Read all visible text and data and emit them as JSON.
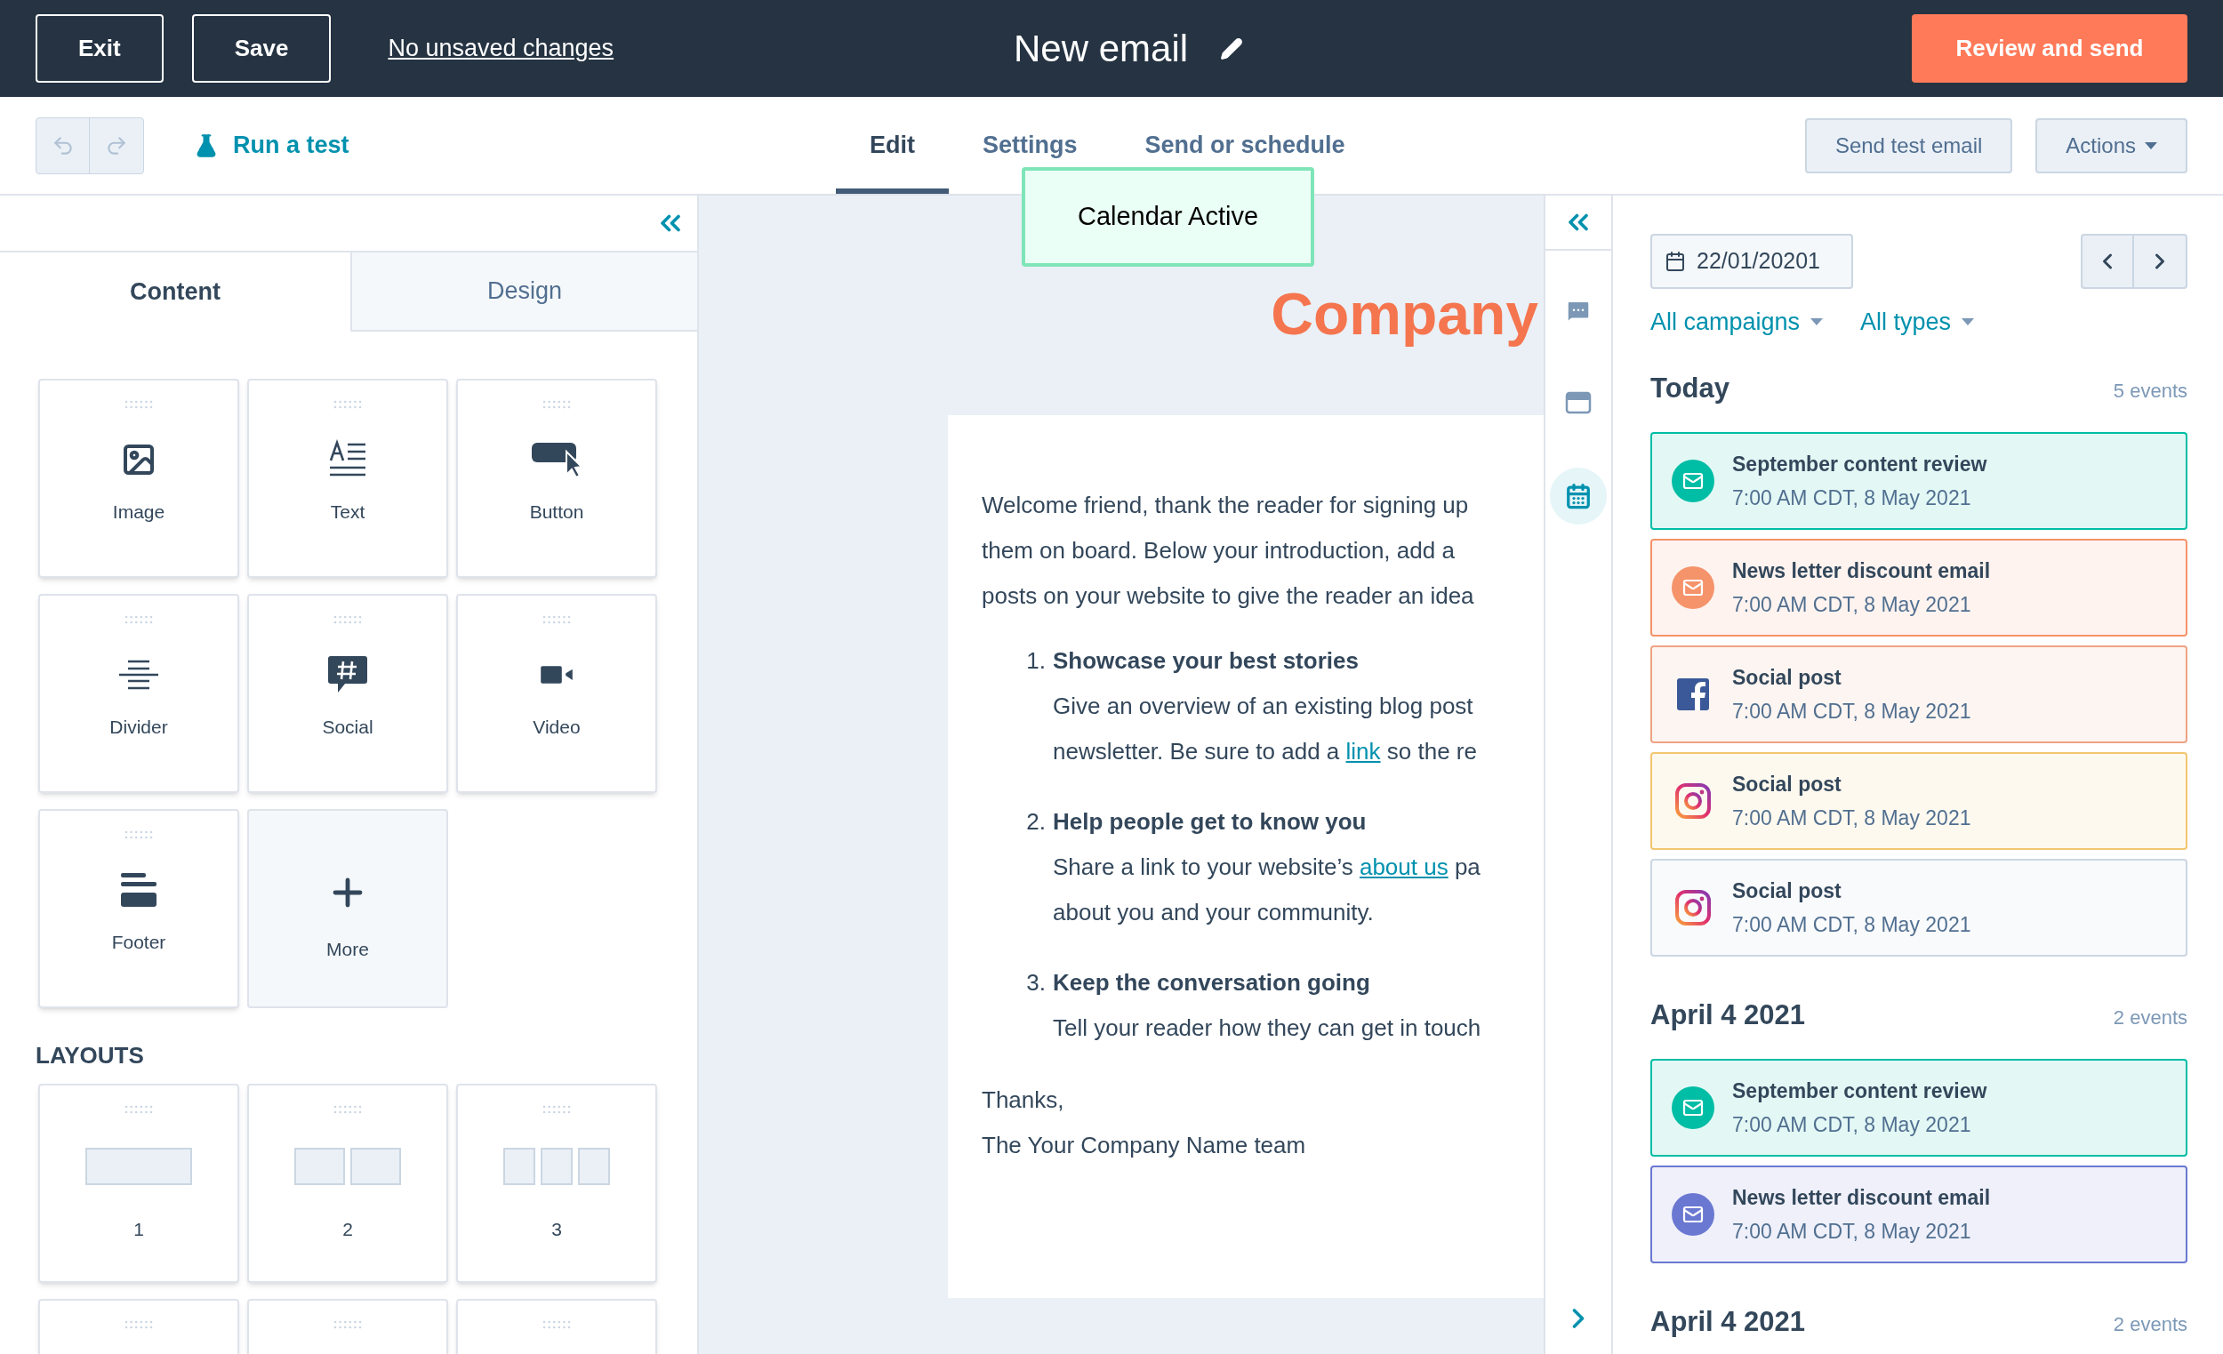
{
  "top_bar": {
    "buttons": [
      "Exit",
      "Save"
    ],
    "status_link": "No unsaved changes",
    "title": "New email",
    "primary_button": "Review and send"
  },
  "toolbar": {
    "run_test": "Run a test",
    "tabs": [
      {
        "label": "Edit",
        "selected": true
      },
      {
        "label": "Settings",
        "selected": false
      },
      {
        "label": "Send or schedule",
        "selected": false
      }
    ],
    "buttons": [
      {
        "label": "Send test email",
        "kind": "plain"
      },
      {
        "label": "Actions",
        "kind": "dropdown"
      }
    ]
  },
  "toast": {
    "text": "Calendar Active"
  },
  "left_panel": {
    "tabs": [
      {
        "label": "Content",
        "selected": true
      },
      {
        "label": "Design",
        "selected": false
      }
    ],
    "modules": [
      {
        "label": "Image",
        "kind": "image"
      },
      {
        "label": "Text",
        "kind": "text"
      },
      {
        "label": "Button",
        "kind": "button"
      },
      {
        "label": "Divider",
        "kind": "divider"
      },
      {
        "label": "Social",
        "kind": "social"
      },
      {
        "label": "Video",
        "kind": "video"
      },
      {
        "label": "Footer",
        "kind": "footer"
      },
      {
        "label": "More",
        "kind": "more"
      }
    ],
    "layouts_heading": "LAYOUTS",
    "layouts": [
      {
        "label": "1"
      },
      {
        "label": "2"
      },
      {
        "label": "3"
      }
    ]
  },
  "email": {
    "brand": "Company",
    "intro_lines": [
      "Welcome friend, thank the reader for signing up",
      "them on board. Below your introduction, add a",
      "posts on your website to give the reader an idea"
    ],
    "items": [
      {
        "number": "1.",
        "title": "Showcase your best stories",
        "lines": [
          [
            {
              "kind": "text",
              "text": "Give an overview of an existing blog post"
            }
          ],
          [
            {
              "kind": "text",
              "text": "newsletter. Be sure to add a "
            },
            {
              "kind": "link",
              "text": "link"
            },
            {
              "kind": "text",
              "text": " so the re"
            }
          ]
        ]
      },
      {
        "number": "2.",
        "title": "Help people get to know you",
        "lines": [
          [
            {
              "kind": "text",
              "text": "Share a link to your website’s "
            },
            {
              "kind": "link",
              "text": "about us"
            },
            {
              "kind": "text",
              "text": " pa"
            }
          ],
          [
            {
              "kind": "text",
              "text": "about you and your community."
            }
          ]
        ]
      },
      {
        "number": "3.",
        "title": "Keep the conversation going",
        "lines": [
          [
            {
              "kind": "text",
              "text": "Tell your reader how they can get in touch"
            }
          ]
        ]
      }
    ],
    "closing_lines": [
      "Thanks,",
      "The Your Company Name team"
    ]
  },
  "side_rail": [
    {
      "kind": "chat",
      "selected": false
    },
    {
      "kind": "window",
      "selected": false
    },
    {
      "kind": "calendar",
      "selected": true
    }
  ],
  "calendar": {
    "date": "22/01/20201",
    "filters": [
      "All campaigns",
      "All types"
    ],
    "sections": [
      {
        "title": "Today",
        "count": "5 events",
        "events": [
          {
            "title": "September content review",
            "time": "7:00 AM CDT, 8 May 2021",
            "kind": "email",
            "color": "#00bda5"
          },
          {
            "title": "News letter discount email",
            "time": "7:00 AM CDT, 8 May 2021",
            "kind": "email",
            "color": "#f5936a"
          },
          {
            "title": "Social post",
            "time": "7:00 AM CDT, 8 May 2021",
            "kind": "facebook",
            "color": "#eea383"
          },
          {
            "title": "Social post",
            "time": "7:00 AM CDT, 8 May 2021",
            "kind": "instagram",
            "color": "#f2c66f"
          },
          {
            "title": "Social post",
            "time": "7:00 AM CDT, 8 May 2021",
            "kind": "instagram",
            "color": "#cbd6e2"
          }
        ]
      },
      {
        "title": "April 4 2021",
        "count": "2 events",
        "events": [
          {
            "title": "September content review",
            "time": "7:00 AM CDT, 8 May 2021",
            "kind": "email",
            "color": "#00bda5"
          },
          {
            "title": "News letter discount email",
            "time": "7:00 AM CDT, 8 May 2021",
            "kind": "email",
            "color": "#6a78d1"
          }
        ]
      },
      {
        "title": "April 4 2021",
        "count": "2 events"
      }
    ]
  }
}
